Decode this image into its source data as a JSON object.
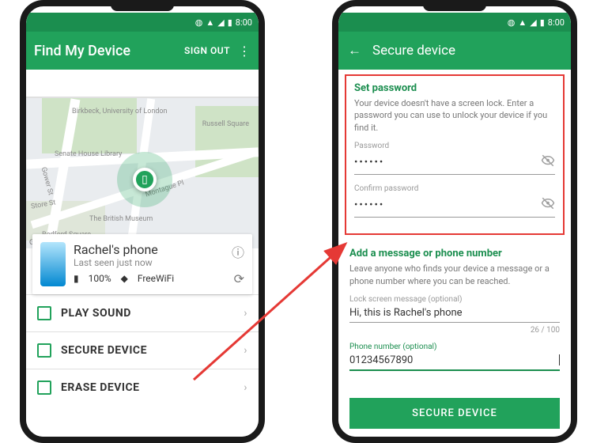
{
  "status": {
    "time": "8:00"
  },
  "left": {
    "app_title": "Find My Device",
    "sign_out": "SIGN OUT",
    "map": {
      "labels": {
        "birkbeck": "Birkbeck, University of London",
        "russell": "Russell Square",
        "senate": "Senate House Library",
        "british": "The British Museum",
        "gower": "Gower St",
        "montague": "Montague Pl",
        "bedford": "Bedford Square",
        "store": "Store St"
      },
      "attribution": "Google"
    },
    "device": {
      "name": "Rachel's phone",
      "seen": "Last seen just now",
      "battery": "100%",
      "wifi": "FreeWiFi"
    },
    "actions": {
      "play": "PLAY SOUND",
      "secure": "SECURE DEVICE",
      "erase": "ERASE DEVICE"
    }
  },
  "right": {
    "title": "Secure device",
    "pw_section": {
      "title": "Set password",
      "help": "Your device doesn't have a screen lock. Enter a password you can use to unlock your device if you find it.",
      "pw_label": "Password",
      "pw_value": "••••••",
      "cpw_label": "Confirm password",
      "cpw_value": "••••••"
    },
    "msg_section": {
      "title": "Add a message or phone number",
      "help": "Leave anyone who finds your device a message or a phone number where you can be reached.",
      "msg_label": "Lock screen message (optional)",
      "msg_value": "Hi, this is Rachel's phone",
      "counter": "26 / 100",
      "phone_label": "Phone number (optional)",
      "phone_value": "01234567890"
    },
    "button": "SECURE DEVICE"
  }
}
